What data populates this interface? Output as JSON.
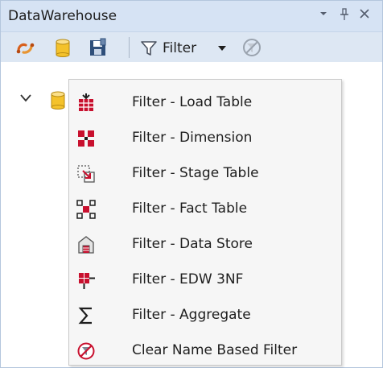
{
  "window": {
    "title": "DataWarehouse",
    "controls": {
      "dropdown_glyph": "▾",
      "pin_glyph": "ᛘ",
      "close_glyph": "✕"
    }
  },
  "toolbar": {
    "buttons": [
      {
        "icon": "refresh-connection-icon"
      },
      {
        "icon": "database-icon"
      },
      {
        "icon": "save-icon"
      }
    ],
    "filter": {
      "label": "Filter",
      "icon": "funnel-icon",
      "caret_icon": "caret-down-icon"
    },
    "clear_filter_icon": "clear-filter-icon"
  },
  "tree": {
    "root": {
      "expand_icon": "chevron-down-icon",
      "icon": "database-icon"
    }
  },
  "menu": {
    "items": [
      {
        "label": "Filter - Load Table",
        "icon": "load-table-icon"
      },
      {
        "label": "Filter - Dimension",
        "icon": "dimension-icon"
      },
      {
        "label": "Filter - Stage Table",
        "icon": "stage-table-icon"
      },
      {
        "label": "Filter - Fact Table",
        "icon": "fact-table-icon"
      },
      {
        "label": "Filter - Data Store",
        "icon": "data-store-icon"
      },
      {
        "label": "Filter - EDW 3NF",
        "icon": "edw-3nf-icon"
      },
      {
        "label": "Filter - Aggregate",
        "icon": "aggregate-sigma-icon"
      },
      {
        "label": "Clear Name Based Filter",
        "icon": "clear-filter-icon"
      }
    ]
  },
  "colors": {
    "accent_red": "#c8102e",
    "titlebar_bg": "#d6e3f4",
    "toolbar_bg": "#dde7f3",
    "menu_bg": "#f6f6f6"
  }
}
